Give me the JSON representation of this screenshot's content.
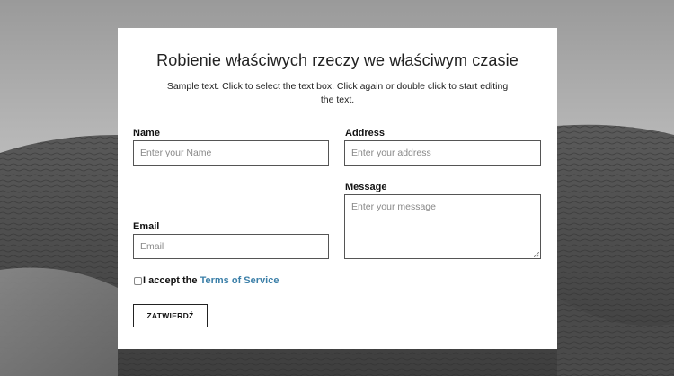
{
  "header": {
    "title": "Robienie właściwych rzeczy we właściwym czasie",
    "subtitle": "Sample text. Click to select the text box. Click again or double click to start editing the text."
  },
  "form": {
    "name": {
      "label": "Name",
      "placeholder": "Enter your Name"
    },
    "address": {
      "label": "Address",
      "placeholder": "Enter your address"
    },
    "message": {
      "label": "Message",
      "placeholder": "Enter your message"
    },
    "email": {
      "label": "Email",
      "placeholder": "Email"
    },
    "consent": {
      "prefix": "I accept the",
      "link": "Terms of Service",
      "checked": false
    },
    "submit_label": "ZATWIERDŹ"
  },
  "colors": {
    "link": "#3b7fa8",
    "card": "#ffffff",
    "border": "#555555"
  }
}
